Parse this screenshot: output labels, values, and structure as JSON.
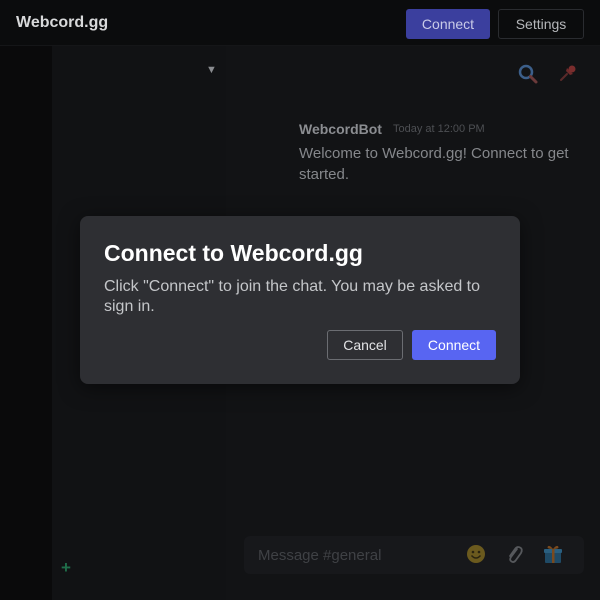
{
  "app": {
    "title": "Webcord.gg"
  },
  "header": {
    "connect_label": "Connect",
    "settings_label": "Settings"
  },
  "channels": {
    "chevron": "▼",
    "add": "+"
  },
  "message": {
    "author": "WebcordBot",
    "timestamp": "Today at 12:00 PM",
    "text": "Welcome to Webcord.gg! Connect to get started."
  },
  "composer": {
    "placeholder": "Message #general"
  },
  "dialog": {
    "title": "Connect to Webcord.gg",
    "body": "Click \"Connect\" to join the chat. You may be asked to sign in.",
    "cancel_label": "Cancel",
    "connect_label": "Connect"
  },
  "icons": {
    "search": "search-icon",
    "pin": "pin-icon",
    "emoji": "emoji-icon",
    "attach": "paperclip-icon",
    "gift": "gift-icon"
  },
  "colors": {
    "accent": "#5865f2",
    "background": "#0e0f11",
    "modal": "#2e2f33"
  }
}
